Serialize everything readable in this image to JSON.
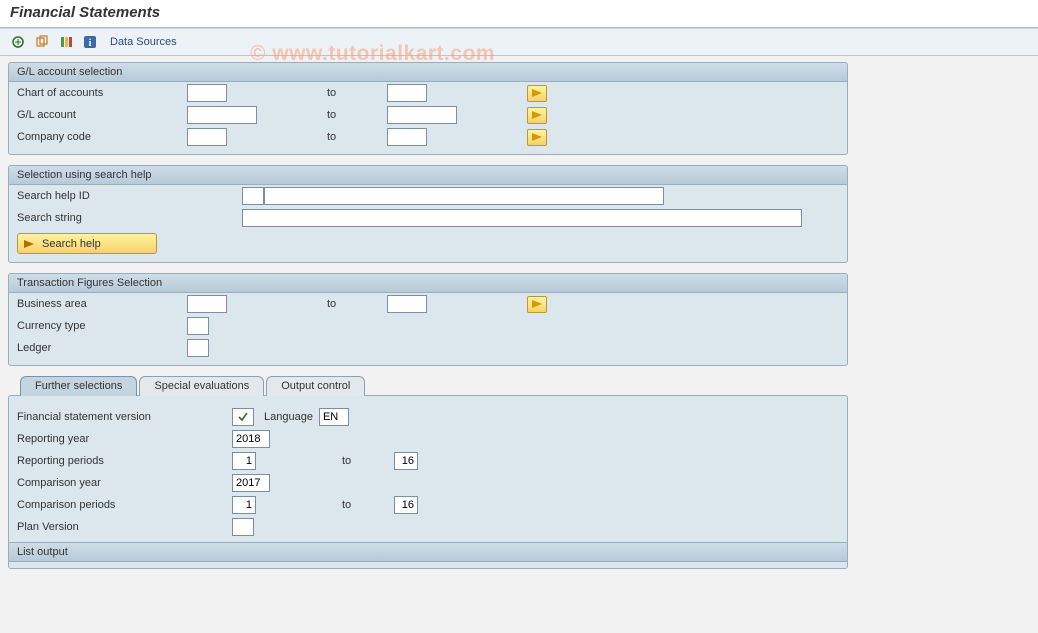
{
  "title": "Financial Statements",
  "watermark": "© www.tutorialkart.com",
  "toolbar": {
    "data_sources": "Data Sources"
  },
  "sections": {
    "gl": {
      "header": "G/L account selection",
      "chart_of_accounts": "Chart of accounts",
      "gl_account": "G/L account",
      "company_code": "Company code",
      "to": "to"
    },
    "search": {
      "header": "Selection using search help",
      "help_id": "Search help ID",
      "search_string": "Search string",
      "search_help_btn": "Search help"
    },
    "trans": {
      "header": "Transaction Figures Selection",
      "business_area": "Business area",
      "currency_type": "Currency type",
      "ledger": "Ledger",
      "to": "to"
    },
    "list_output": "List output"
  },
  "tabs": {
    "further": "Further selections",
    "special": "Special evaluations",
    "output": "Output control"
  },
  "further": {
    "fsv": "Financial statement version",
    "language_label": "Language",
    "language_value": "EN",
    "reporting_year_label": "Reporting year",
    "reporting_year_value": "2018",
    "reporting_periods_label": "Reporting periods",
    "reporting_periods_from": "1",
    "reporting_periods_to": "16",
    "comparison_year_label": "Comparison year",
    "comparison_year_value": "2017",
    "comparison_periods_label": "Comparison periods",
    "comparison_periods_from": "1",
    "comparison_periods_to": "16",
    "plan_version_label": "Plan Version",
    "to": "to"
  }
}
